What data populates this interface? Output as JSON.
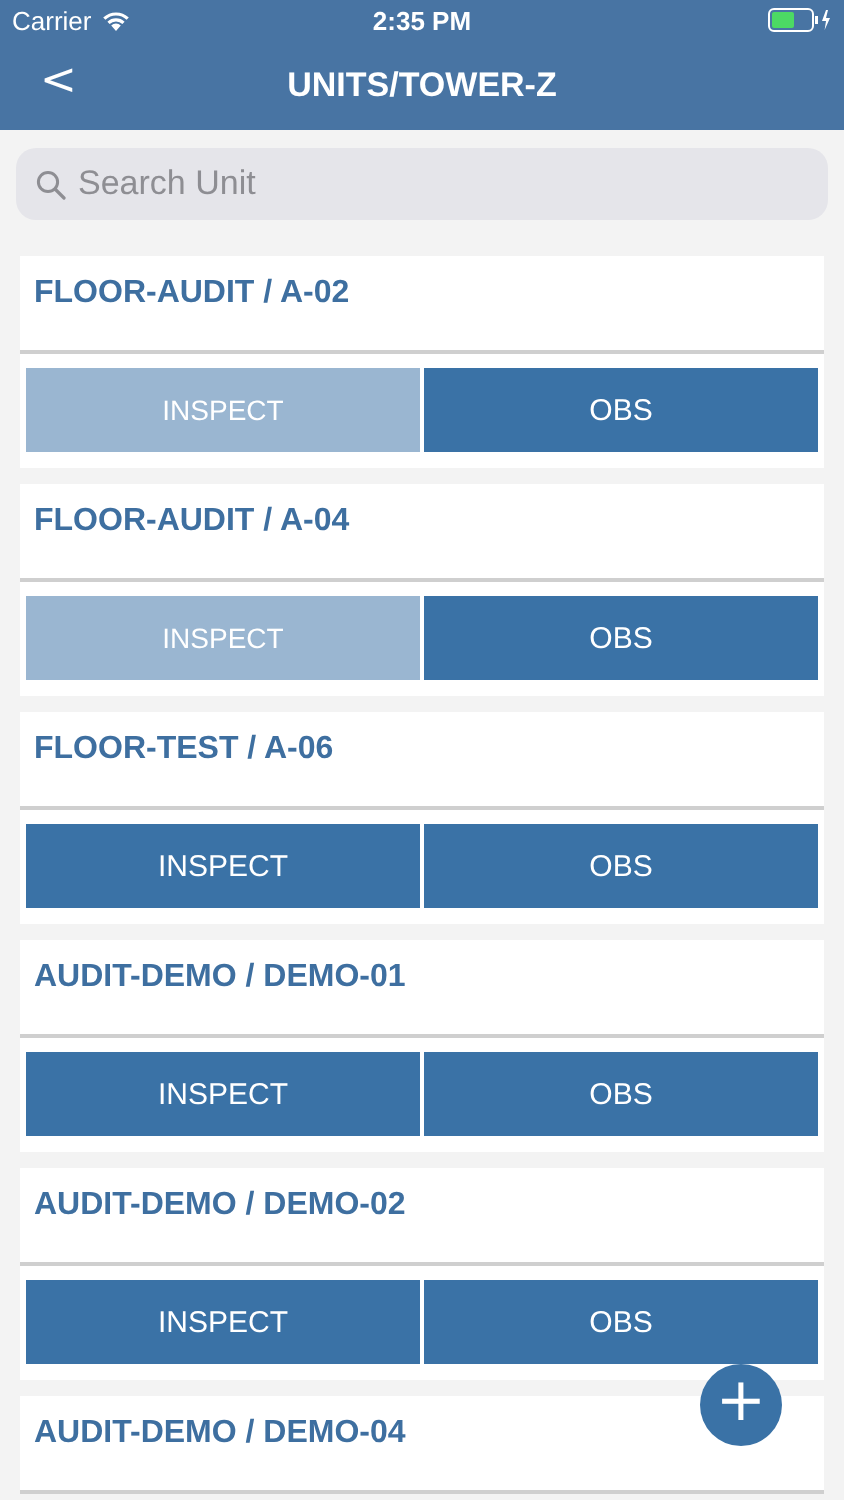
{
  "status_bar": {
    "carrier": "Carrier",
    "time": "2:35 PM"
  },
  "header": {
    "back": "<",
    "title": "UNITS/TOWER-Z"
  },
  "search": {
    "placeholder": "Search Unit"
  },
  "units": [
    {
      "title": "FLOOR-AUDIT / A-02",
      "actions": [
        {
          "label": "INSPECT",
          "disabled": true
        },
        {
          "label": "OBS",
          "disabled": false
        }
      ]
    },
    {
      "title": "FLOOR-AUDIT / A-04",
      "actions": [
        {
          "label": "INSPECT",
          "disabled": true
        },
        {
          "label": "OBS",
          "disabled": false
        }
      ]
    },
    {
      "title": "FLOOR-TEST / A-06",
      "actions": [
        {
          "label": "INSPECT",
          "disabled": false
        },
        {
          "label": "OBS",
          "disabled": false
        }
      ]
    },
    {
      "title": "AUDIT-DEMO / DEMO-01",
      "actions": [
        {
          "label": "INSPECT",
          "disabled": false
        },
        {
          "label": "OBS",
          "disabled": false
        }
      ]
    },
    {
      "title": "AUDIT-DEMO / DEMO-02",
      "actions": [
        {
          "label": "INSPECT",
          "disabled": false
        },
        {
          "label": "OBS",
          "disabled": false
        }
      ]
    },
    {
      "title": "AUDIT-DEMO / DEMO-04"
    }
  ],
  "fab": "+"
}
